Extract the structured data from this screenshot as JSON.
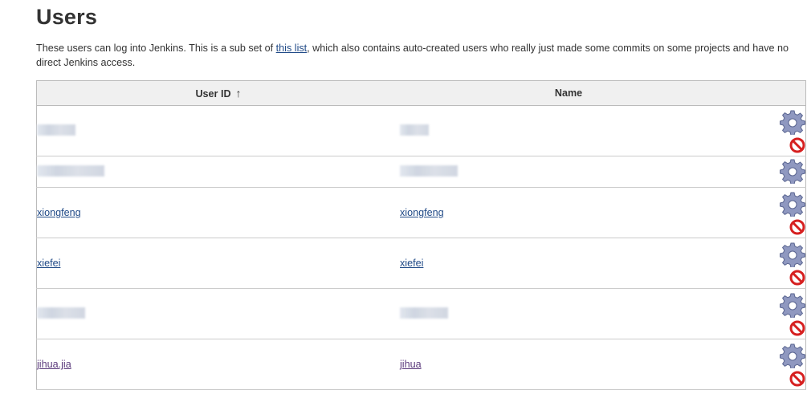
{
  "page": {
    "title": "Users",
    "description_before": "These users can log into Jenkins. This is a sub set of ",
    "description_link": "this list",
    "description_after": ", which also contains auto-created users who really just made some commits on some projects and have no direct Jenkins access."
  },
  "table": {
    "columns": [
      {
        "label": "User ID",
        "sort_indicator": "↑"
      },
      {
        "label": "Name"
      }
    ],
    "rows": [
      {
        "user_id": "",
        "name": "",
        "redacted": true,
        "has_delete": true
      },
      {
        "user_id": "",
        "name": "",
        "redacted": true,
        "has_delete": false
      },
      {
        "user_id": "xiongfeng",
        "name": "xiongfeng",
        "redacted": false,
        "has_delete": true
      },
      {
        "user_id": "xiefei",
        "name": "xiefei",
        "redacted": false,
        "has_delete": true
      },
      {
        "user_id": "",
        "name": "",
        "redacted": true,
        "has_delete": true
      },
      {
        "user_id": "jihua.jia",
        "name": "jihua",
        "redacted": false,
        "has_delete": true
      }
    ]
  },
  "icons": {
    "configure": "gear-icon",
    "delete": "delete-icon"
  },
  "colors": {
    "link": "#204a87",
    "header_bg": "#f0f0f0",
    "delete_red": "#d62020"
  }
}
